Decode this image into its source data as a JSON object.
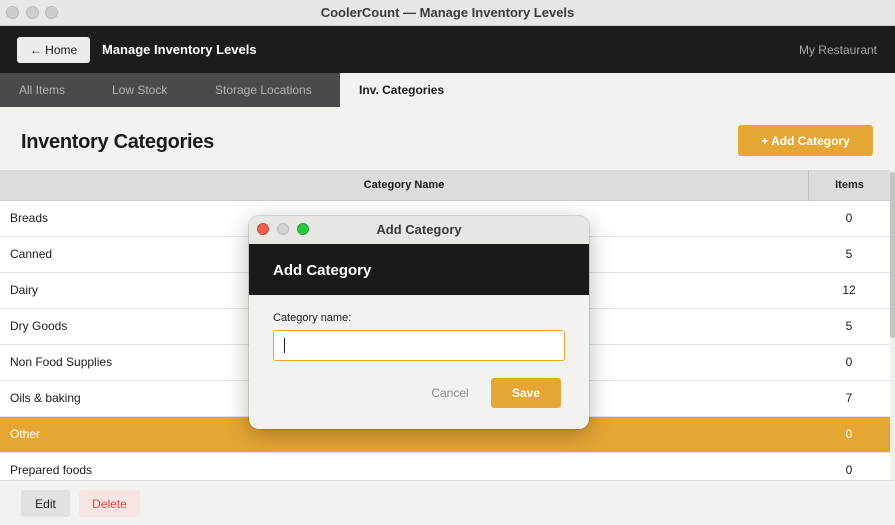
{
  "window": {
    "title": "CoolerCount — Manage Inventory Levels"
  },
  "header": {
    "home_label": "← Home",
    "title": "Manage Inventory Levels",
    "restaurant": "My Restaurant"
  },
  "tabs": [
    {
      "label": "All Items",
      "active": false
    },
    {
      "label": "Low Stock",
      "active": false
    },
    {
      "label": "Storage Locations",
      "active": false
    },
    {
      "label": "Inv. Categories",
      "active": true
    }
  ],
  "section": {
    "title": "Inventory Categories",
    "add_button": "+ Add Category"
  },
  "table": {
    "columns": [
      "Category Name",
      "Items"
    ],
    "rows": [
      {
        "name": "Breads",
        "items": "0",
        "selected": false
      },
      {
        "name": "Canned",
        "items": "5",
        "selected": false
      },
      {
        "name": "Dairy",
        "items": "12",
        "selected": false
      },
      {
        "name": "Dry Goods",
        "items": "5",
        "selected": false
      },
      {
        "name": "Non Food Supplies",
        "items": "0",
        "selected": false
      },
      {
        "name": "Oils & baking",
        "items": "7",
        "selected": false
      },
      {
        "name": "Other",
        "items": "0",
        "selected": true
      },
      {
        "name": "Prepared foods",
        "items": "0",
        "selected": false
      }
    ]
  },
  "footer": {
    "edit_label": "Edit",
    "delete_label": "Delete"
  },
  "modal": {
    "window_title": "Add Category",
    "heading": "Add Category",
    "field_label": "Category name:",
    "field_value": "",
    "cancel_label": "Cancel",
    "save_label": "Save"
  },
  "colors": {
    "accent": "#e6a634",
    "header_bg": "#1c1c1c",
    "danger": "#d64a40"
  }
}
